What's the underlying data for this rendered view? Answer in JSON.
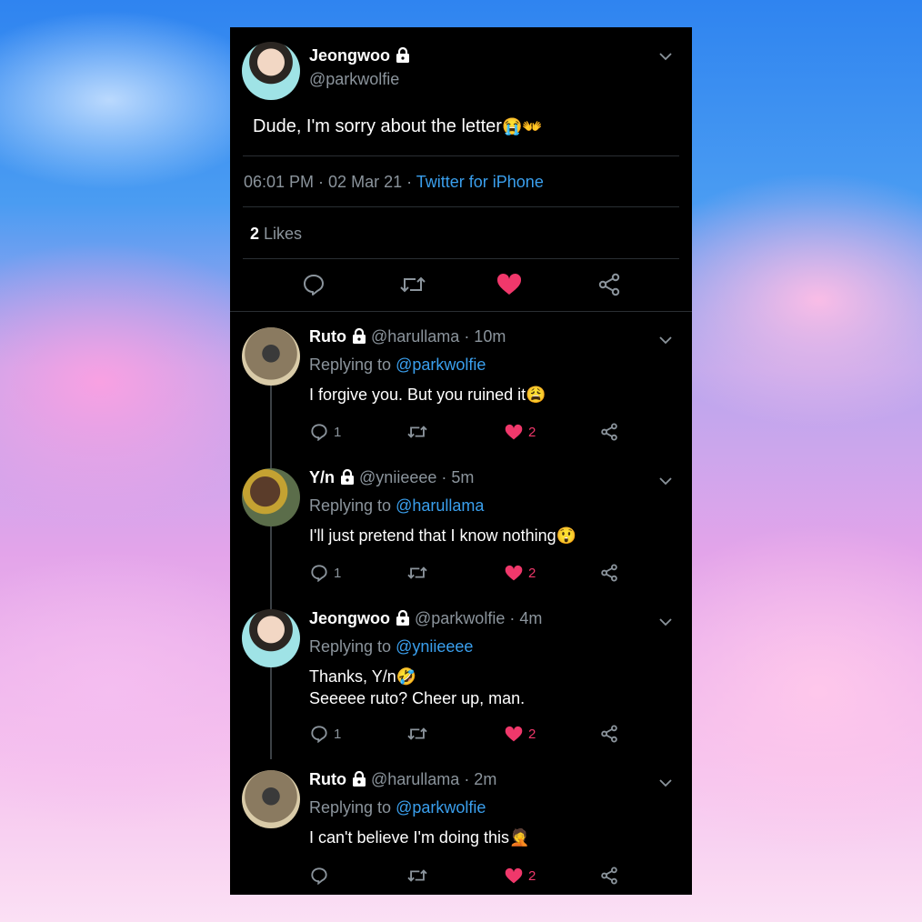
{
  "main": {
    "author_name": "Jeongwoo",
    "author_handle": "@parkwolfie",
    "text": "Dude, I'm sorry about the letter",
    "emoji": "😭👐",
    "time": "06:01 PM",
    "date_sep": " · ",
    "date": "02 Mar 21",
    "client_sep": " · ",
    "client": "Twitter for iPhone",
    "likes_count": "2",
    "likes_label": " Likes"
  },
  "replies": [
    {
      "name": "Ruto",
      "handle": "@harullama · 10m",
      "replying_label": "Replying to ",
      "replying_to": "@parkwolfie",
      "text_line1": "I forgive you. But you ruined it",
      "emoji": "😩",
      "text_line2": "",
      "reply_count": "1",
      "like_count": "2"
    },
    {
      "name": "Y/n",
      "handle": "@yniieeee · 5m",
      "replying_label": "Replying to ",
      "replying_to": "@harullama",
      "text_line1": "I'll just pretend that I know nothing",
      "emoji": "😲",
      "text_line2": "",
      "reply_count": "1",
      "like_count": "2"
    },
    {
      "name": "Jeongwoo",
      "handle": "@parkwolfie · 4m",
      "replying_label": "Replying to ",
      "replying_to": "@yniieeee",
      "text_line1": "Thanks, Y/n",
      "emoji": "🤣",
      "text_line2": "Seeeee ruto? Cheer up, man.",
      "reply_count": "1",
      "like_count": "2"
    },
    {
      "name": "Ruto",
      "handle": "@harullama · 2m",
      "replying_label": "Replying to ",
      "replying_to": "@parkwolfie",
      "text_line1": "I can't believe I'm doing this",
      "emoji": "🤦",
      "text_line2": "",
      "reply_count": "",
      "like_count": "2"
    }
  ],
  "icons": {
    "reply": "reply-icon",
    "retweet": "retweet-icon",
    "like": "heart-icon",
    "share": "share-icon",
    "lock": "lock-icon",
    "chevron": "chevron-down-icon"
  },
  "colors": {
    "accent": "#3a9fed",
    "like": "#f0386b",
    "muted": "#8b949c",
    "background": "#000000"
  }
}
